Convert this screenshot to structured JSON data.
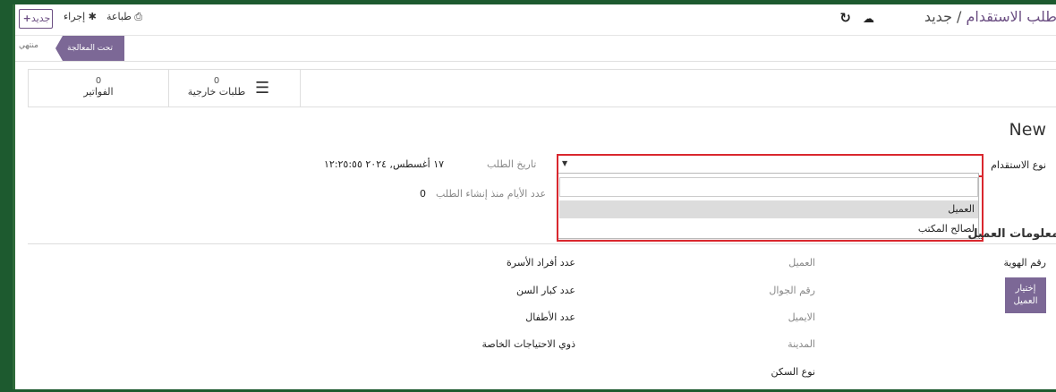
{
  "header": {
    "breadcrumb_main": "طلب الاستقدام",
    "breadcrumb_sep": " / ",
    "breadcrumb_current": "جديد",
    "new_button": "جديد",
    "print_label": "طباعة",
    "action_label": "إجراء"
  },
  "statusbar": {
    "stage_active": "تحت المعالجة",
    "stage_done": "منتهي"
  },
  "smart_buttons": [
    {
      "count": "0",
      "label": "طلبات خارجية",
      "icon": "list-icon"
    },
    {
      "count": "0",
      "label": "الفواتير",
      "icon": ""
    }
  ],
  "form": {
    "title": "New",
    "recruitment_type_label": "نوع الاستقدام",
    "order_date_label": "تاريخ الطلب",
    "order_date_value": "١٧ أغسطس, ٢٠٢٤ ١٢:٢٥:٥٥",
    "days_since_label": "عدد الأيام منذ إنشاء الطلب",
    "days_since_value": "0",
    "dropdown_options": [
      "العميل",
      "لصالح المكتب"
    ],
    "dropdown_selected": "العميل",
    "section_title": "معلومات العميل",
    "id_number_label": "رقم الهوية",
    "choose_client_button": "إختيار العميل",
    "client_fields": [
      "العميل",
      "رقم الجوال",
      "الايميل",
      "المدينة"
    ],
    "housing_type_label": "نوع السكن",
    "family_fields": [
      "عدد أفراد الأسرة",
      "عدد كبار السن",
      "عدد الأطفال",
      "ذوي الاحتياجات الخاصة"
    ]
  },
  "colors": {
    "accent": "#7c6896",
    "highlight": "#d9272e",
    "outer_bg": "#1d5a2f"
  }
}
